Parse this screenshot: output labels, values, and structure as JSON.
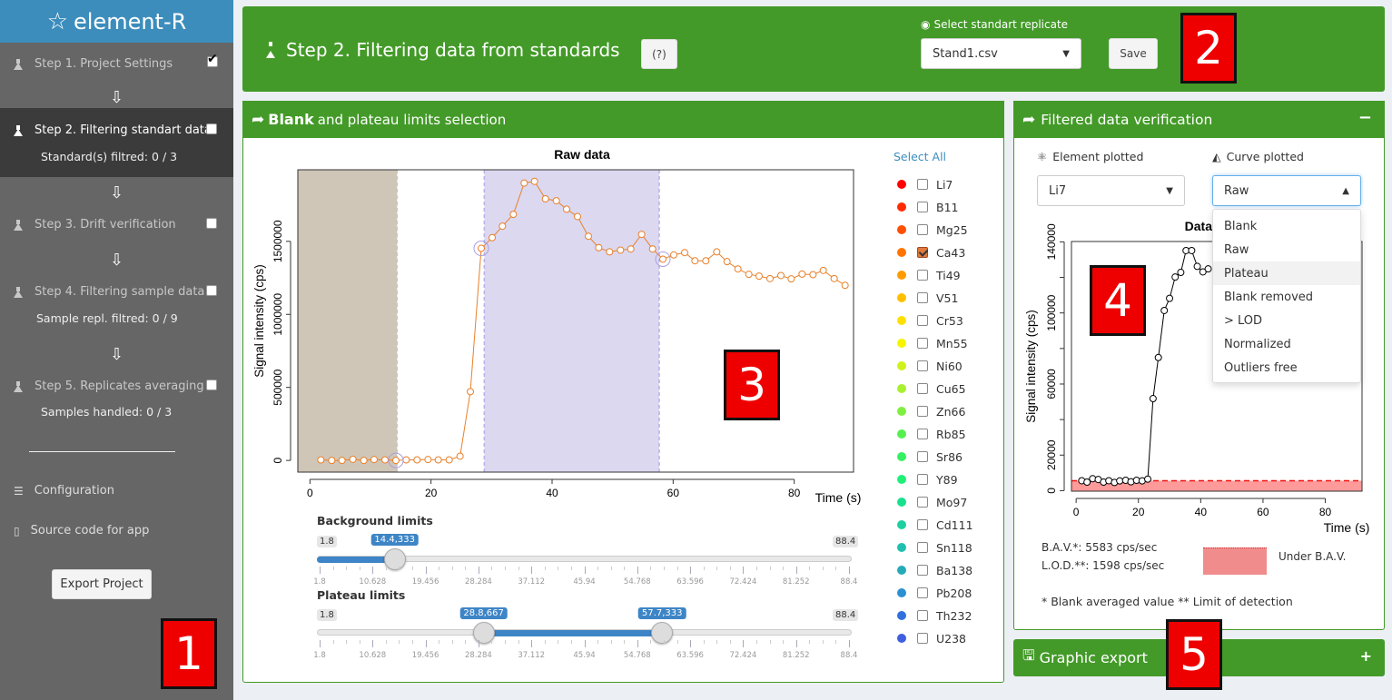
{
  "sidebar": {
    "brand": "element-R",
    "steps": [
      {
        "label": "Step 1. Project Settings",
        "checked": true
      },
      {
        "label": "Step 2. Filtering standart data",
        "sub": "Standard(s) filtred: 0 / 3",
        "checked": false,
        "active": true
      },
      {
        "label": "Step 3. Drift verification",
        "checked": false
      },
      {
        "label": "Step 4. Filtering sample data",
        "sub": "Sample repl. filtred: 0 / 9",
        "checked": false
      },
      {
        "label": "Step 5. Replicates averaging",
        "sub": "Samples handled: 0 / 3",
        "checked": false
      }
    ],
    "configuration": "Configuration",
    "source_code": "Source code for app",
    "export_button": "Export Project"
  },
  "header": {
    "title": "Step 2. Filtering data from standards",
    "help_button": "(?)",
    "replicate_label": "Select standart replicate",
    "replicate_value": "Stand1.csv",
    "save_button": "Save"
  },
  "annotations": [
    "1",
    "2",
    "3",
    "4",
    "5"
  ],
  "left_panel": {
    "title_bold": "Blank",
    "title_rest": "and plateau limits selection",
    "select_all": "Select All",
    "elements": [
      {
        "name": "Li7",
        "color": "#ff0000",
        "checked": false
      },
      {
        "name": "B11",
        "color": "#ff2a00",
        "checked": false
      },
      {
        "name": "Mg25",
        "color": "#ff5000",
        "checked": false
      },
      {
        "name": "Ca43",
        "color": "#ff7500",
        "checked": true
      },
      {
        "name": "Ti49",
        "color": "#ff9a00",
        "checked": false
      },
      {
        "name": "V51",
        "color": "#ffbf00",
        "checked": false
      },
      {
        "name": "Cr53",
        "color": "#ffe000",
        "checked": false
      },
      {
        "name": "Mn55",
        "color": "#f5f500",
        "checked": false
      },
      {
        "name": "Ni60",
        "color": "#cff21a",
        "checked": false
      },
      {
        "name": "Cu65",
        "color": "#a8f030",
        "checked": false
      },
      {
        "name": "Zn66",
        "color": "#80f040",
        "checked": false
      },
      {
        "name": "Rb85",
        "color": "#55f050",
        "checked": false
      },
      {
        "name": "Sr86",
        "color": "#35f060",
        "checked": false
      },
      {
        "name": "Y89",
        "color": "#1ff078",
        "checked": false
      },
      {
        "name": "Mo97",
        "color": "#18e090",
        "checked": false
      },
      {
        "name": "Cd111",
        "color": "#1ccfa0",
        "checked": false
      },
      {
        "name": "Sn118",
        "color": "#20c0b0",
        "checked": false
      },
      {
        "name": "Ba138",
        "color": "#25aab8",
        "checked": false
      },
      {
        "name": "Pb208",
        "color": "#2a90d0",
        "checked": false
      },
      {
        "name": "Th232",
        "color": "#3070dd",
        "checked": false
      },
      {
        "name": "U238",
        "color": "#3f5ee0",
        "checked": false
      }
    ],
    "background_slider": {
      "label": "Background limits",
      "min": 1.8,
      "max": 88.4,
      "values": [
        1.8,
        14.4
      ],
      "bubble": "14.4,333"
    },
    "plateau_slider": {
      "label": "Plateau limits",
      "min": 1.8,
      "max": 88.4,
      "values": [
        28.8,
        57.7
      ],
      "bubbles": [
        "28.8,667",
        "57.7,333"
      ]
    },
    "slider_ticks": [
      "1.8",
      "10.628",
      "19.456",
      "28.284",
      "37.112",
      "45.94",
      "54.768",
      "63.596",
      "72.424",
      "81.252",
      "88.4"
    ]
  },
  "right_panel": {
    "title": "Filtered data verification",
    "collapse": "−",
    "element_label": "Element plotted",
    "element_value": "Li7",
    "curve_label": "Curve plotted",
    "curve_value": "Raw",
    "curve_options": [
      "Blank",
      "Raw",
      "Plateau",
      "Blank removed",
      "> LOD",
      "Normalized",
      "Outliers free"
    ],
    "highlighted_option": "Plateau",
    "bav": "B.A.V.*: 5583 cps/sec",
    "lod": "L.O.D.**: 1598 cps/sec",
    "legend_label": "Under B.A.V.",
    "legend_color": "#f08c8c",
    "footnote": "* Blank averaged value ** Limit of detection"
  },
  "graphic_export": {
    "title": "Graphic export",
    "expand": "+"
  },
  "chart_data": [
    {
      "type": "line",
      "title": "Raw data",
      "xlabel": "Time (s)",
      "ylabel": "Signal intensity (cps)",
      "xlim": [
        -2,
        89.8
      ],
      "ylim": [
        -80000,
        1990000
      ],
      "xticks": [
        0,
        20,
        40,
        60,
        80
      ],
      "yticks": [
        0,
        500000,
        1000000,
        1500000
      ],
      "color": "#e8802a",
      "background_region": [
        -2,
        14.4
      ],
      "background_color": "#cfc6b8",
      "plateau_region": [
        28.8,
        57.7
      ],
      "plateau_color": "#dcd8f0",
      "x": [
        1.8,
        3.6,
        5.3,
        7.1,
        8.9,
        10.6,
        12.4,
        14.2,
        15.9,
        17.7,
        19.5,
        21.2,
        23.0,
        24.8,
        26.5,
        28.3,
        30.1,
        31.8,
        33.6,
        35.4,
        37.1,
        38.9,
        40.7,
        42.4,
        44.2,
        46.0,
        47.7,
        49.5,
        51.3,
        53.0,
        54.8,
        56.6,
        58.3,
        60.1,
        61.9,
        63.6,
        65.4,
        67.2,
        68.9,
        70.7,
        72.5,
        74.2,
        76.0,
        77.8,
        79.5,
        81.3,
        83.1,
        84.8,
        86.6,
        88.4
      ],
      "y": [
        4000,
        0,
        0,
        8000,
        0,
        6000,
        4000,
        0,
        4000,
        4000,
        6000,
        4000,
        4000,
        29000,
        471000,
        1452000,
        1525000,
        1604000,
        1685000,
        1899000,
        1911000,
        1791000,
        1778000,
        1720000,
        1670000,
        1535000,
        1457000,
        1428000,
        1440000,
        1448000,
        1548000,
        1448000,
        1378000,
        1407000,
        1423000,
        1367000,
        1367000,
        1428000,
        1361000,
        1311000,
        1274000,
        1262000,
        1245000,
        1266000,
        1243000,
        1276000,
        1272000,
        1301000,
        1245000,
        1199000
      ],
      "highlighted_x": [
        14.2,
        28.3,
        58.3
      ]
    },
    {
      "type": "line",
      "title": "Data",
      "xlabel": "Time (s)",
      "ylabel": "Signal intensity (cps)",
      "xlim": [
        -1.5,
        91.8
      ],
      "ylim": [
        -300,
        140200
      ],
      "xticks": [
        0,
        20,
        40,
        60,
        80
      ],
      "yticks": [
        0,
        20000,
        40000,
        60000,
        80000,
        100000,
        120000,
        140000
      ],
      "ytick_labels": [
        "0",
        "20000",
        "",
        "60000",
        "",
        "100000",
        "",
        "140000"
      ],
      "color": "#000000",
      "bav_line": 5583,
      "bav_color": "#ee1111",
      "x": [
        1.8,
        3.5,
        5.3,
        7.1,
        8.8,
        10.5,
        12.3,
        14.0,
        15.9,
        17.6,
        19.4,
        21.2,
        23.0,
        24.7,
        26.4,
        28.3,
        30.0,
        31.8,
        33.6,
        35.3,
        37.1,
        38.9,
        40.7,
        42.4
      ],
      "y": [
        5600,
        4800,
        6700,
        6300,
        4800,
        5600,
        4600,
        5500,
        5800,
        5000,
        5800,
        5500,
        6500,
        51800,
        74900,
        101400,
        108200,
        120200,
        122800,
        135100,
        135100,
        126200,
        123100,
        124800
      ]
    }
  ]
}
